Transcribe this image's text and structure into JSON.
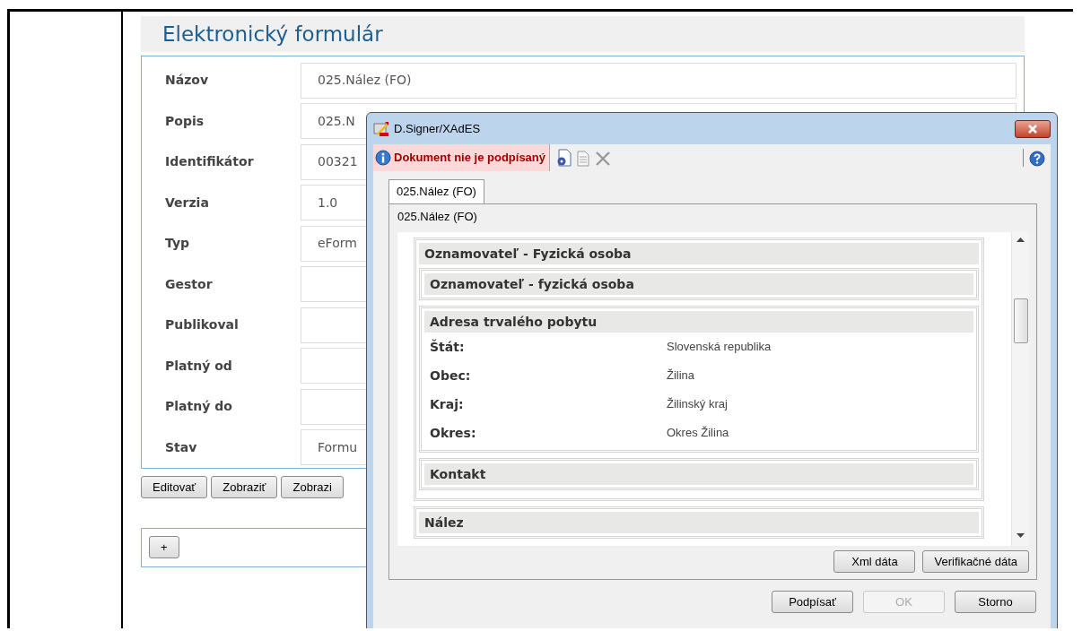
{
  "page_title": "Elektronický formulár",
  "form_fields": [
    {
      "label": "Názov",
      "value": "025.Nález (FO)"
    },
    {
      "label": "Popis",
      "value": "025.N"
    },
    {
      "label": "Identifikátor",
      "value": "00321"
    },
    {
      "label": "Verzia",
      "value": "1.0"
    },
    {
      "label": "Typ",
      "value": "eForm"
    },
    {
      "label": "Gestor"
    },
    {
      "label": "Publikoval"
    },
    {
      "label": "Platný od"
    },
    {
      "label": "Platný do"
    },
    {
      "label": "Stav",
      "value": "Formu"
    }
  ],
  "actions": [
    "Editovať",
    "Zobraziť",
    "Zobrazi"
  ],
  "add_button": "+",
  "dialog": {
    "title": "D.Signer/XAdES",
    "status": "Dokument nie je podpísaný",
    "tabs": [
      {
        "label": "025.Nález (FO)",
        "selected": true
      }
    ],
    "document_title": "025.Nález (FO)",
    "sections": [
      {
        "heading": "Oznamovateľ - Fyzická osoba",
        "children": [
          {
            "heading": "Oznamovateľ - fyzická osoba"
          },
          {
            "heading": "Adresa trvalého pobytu",
            "rows": [
              {
                "label": "Štát:",
                "value": "Slovenská republika"
              },
              {
                "label": "Obec:",
                "value": "Žilina"
              },
              {
                "label": "Kraj:",
                "value": "Žilinský kraj"
              },
              {
                "label": "Okres:",
                "value": "Okres Žilina"
              }
            ]
          },
          {
            "heading": "Kontakt"
          }
        ]
      },
      {
        "heading": "Nález"
      }
    ],
    "panel_buttons": [
      "Xml dáta",
      "Verifikačné dáta"
    ],
    "buttons": [
      {
        "label": "Podpísať",
        "disabled": false
      },
      {
        "label": "OK",
        "disabled": true
      },
      {
        "label": "Storno",
        "disabled": false
      }
    ]
  }
}
